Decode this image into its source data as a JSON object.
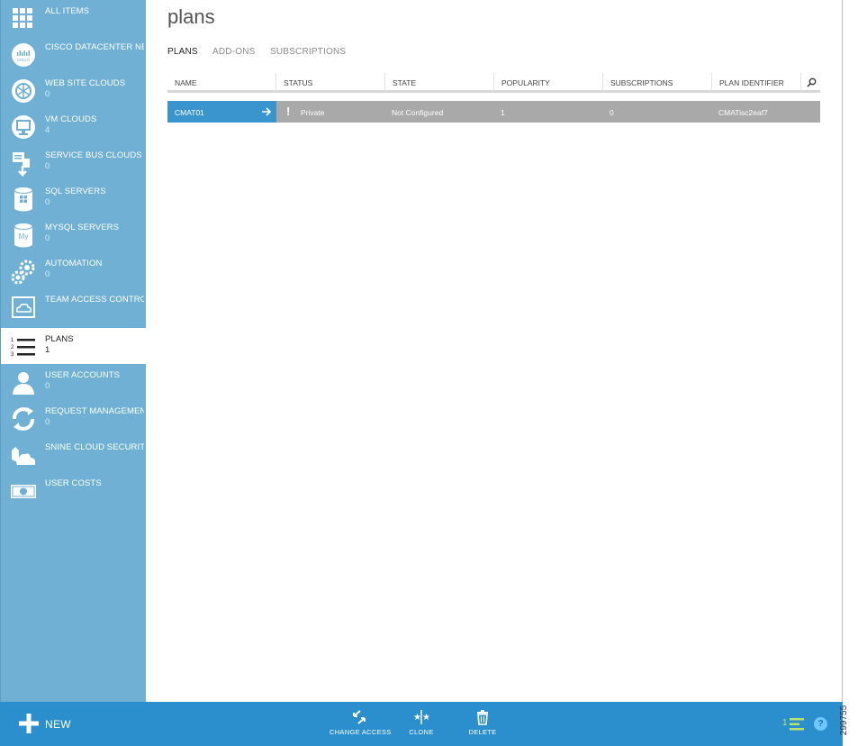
{
  "page": {
    "title": "plans",
    "figure_id": "299755"
  },
  "sidebar": {
    "items": [
      {
        "label": "ALL ITEMS",
        "count": "",
        "icon": "grid-icon"
      },
      {
        "label": "CISCO DATACENTER NET...",
        "count": "",
        "icon": "cisco-icon"
      },
      {
        "label": "WEB SITE CLOUDS",
        "count": "0",
        "icon": "globe-icon"
      },
      {
        "label": "VM CLOUDS",
        "count": "4",
        "icon": "monitor-icon"
      },
      {
        "label": "SERVICE BUS CLOUDS",
        "count": "0",
        "icon": "service-bus-icon"
      },
      {
        "label": "SQL SERVERS",
        "count": "0",
        "icon": "database-icon"
      },
      {
        "label": "MYSQL SERVERS",
        "count": "0",
        "icon": "mysql-icon"
      },
      {
        "label": "AUTOMATION",
        "count": "0",
        "icon": "gears-icon"
      },
      {
        "label": "TEAM ACCESS CONTROL",
        "count": "",
        "icon": "cloud-box-icon"
      },
      {
        "label": "PLANS",
        "count": "1",
        "icon": "numbered-list-icon"
      },
      {
        "label": "USER ACCOUNTS",
        "count": "0",
        "icon": "user-icon"
      },
      {
        "label": "REQUEST MANAGEMENT",
        "count": "0",
        "icon": "refresh-icon"
      },
      {
        "label": "SNINE CLOUD SECURITY",
        "count": "",
        "icon": "cloud-shield-icon"
      },
      {
        "label": "USER COSTS",
        "count": "",
        "icon": "money-icon"
      }
    ]
  },
  "tabs": [
    "PLANS",
    "ADD-ONS",
    "SUBSCRIPTIONS"
  ],
  "table": {
    "columns": [
      "NAME",
      "STATUS",
      "STATE",
      "POPULARITY",
      "SUBSCRIPTIONS",
      "PLAN IDENTIFIER"
    ],
    "rows": [
      {
        "name": "CMAT01",
        "status": "Private",
        "state": "Not Configured",
        "popularity": "1",
        "subscriptions": "0",
        "plan_identifier": "CMATisc2eaf7"
      }
    ]
  },
  "bottombar": {
    "new_label": "NEW",
    "commands": [
      "CHANGE ACCESS",
      "CLONE",
      "DELETE"
    ],
    "notification_count": "1",
    "help_label": "?"
  },
  "colors": {
    "sidebar": "#6fb0d4",
    "bottombar": "#2b8fcd",
    "selected_cell": "#3a95cf",
    "row": "#a9a9a9"
  }
}
